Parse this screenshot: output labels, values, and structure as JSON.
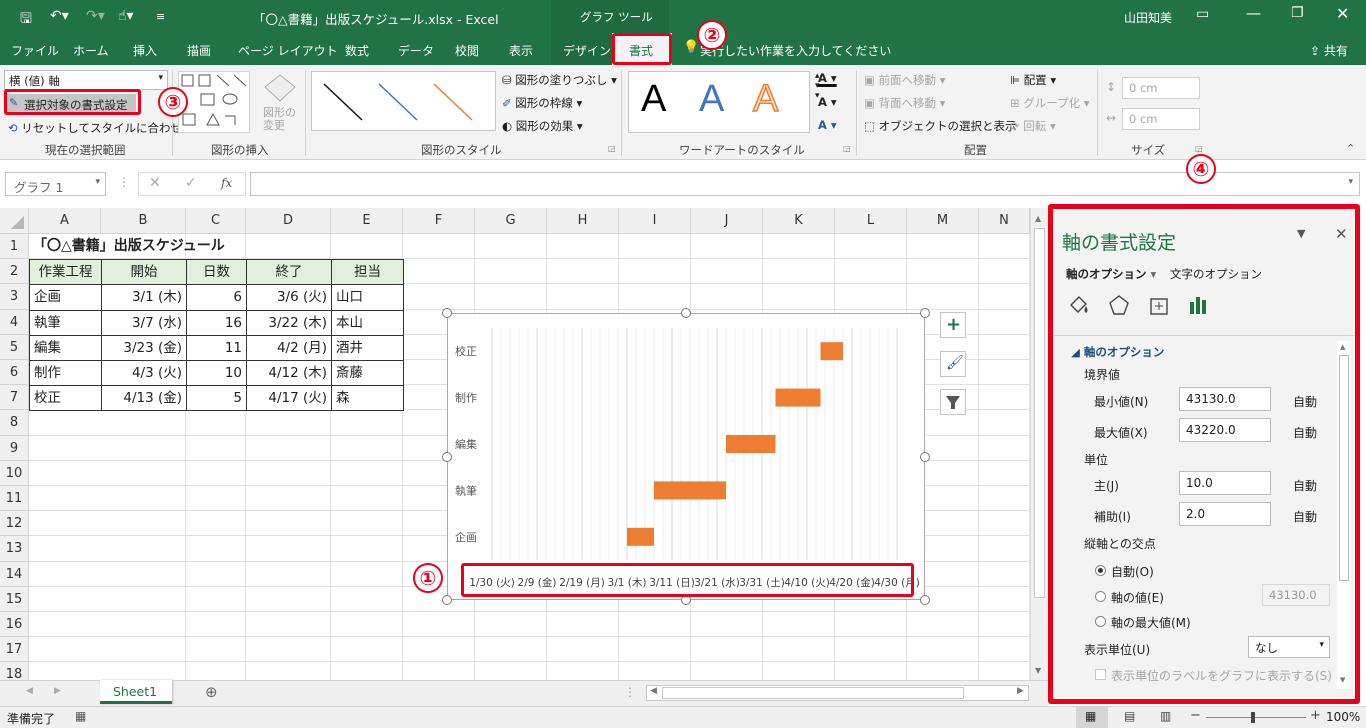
{
  "title_bar": {
    "filename": "「〇△書籍」出版スケジュール.xlsx",
    "separator": "-",
    "app": "Excel",
    "context_tool": "グラフ ツール",
    "user": "山田知美"
  },
  "tabs": {
    "file": "ファイル",
    "home": "ホーム",
    "insert": "挿入",
    "draw": "描画",
    "page_layout": "ページ レイアウト",
    "formulas": "数式",
    "data": "データ",
    "review": "校閲",
    "view": "表示",
    "design": "デザイン",
    "format": "書式",
    "tell_me": "実行したい作業を入力してください",
    "share": "共有"
  },
  "ribbon": {
    "selection_dropdown": "横 (値) 軸",
    "format_selection": "選択対象の書式設定",
    "reset_style": "リセットしてスタイルに合わせる",
    "group_selection": "現在の選択範囲",
    "change_shape": "図形の変更",
    "group_insert_shapes": "図形の挿入",
    "shape_fill": "図形の塗りつぶし",
    "shape_outline": "図形の枠線",
    "shape_effects": "図形の効果",
    "group_shape_styles": "図形のスタイル",
    "wordart_letter": "A",
    "group_wordart": "ワードアートのスタイル",
    "bring_forward": "前面へ移動",
    "send_backward": "背面へ移動",
    "selection_pane": "オブジェクトの選択と表示",
    "align": "配置",
    "group_obj": "グループ化",
    "rotate": "回転",
    "group_arrange": "配置",
    "height": "0 cm",
    "width": "0 cm",
    "group_size": "サイズ"
  },
  "formula_bar": {
    "name_box": "グラフ 1",
    "fx": "fx",
    "value": ""
  },
  "grid": {
    "columns": [
      "A",
      "B",
      "C",
      "D",
      "E",
      "F",
      "G",
      "H",
      "I",
      "J",
      "K",
      "L",
      "M",
      "N"
    ],
    "rows": [
      "1",
      "2",
      "3",
      "4",
      "5",
      "6",
      "7",
      "8",
      "9",
      "10",
      "11",
      "12",
      "13",
      "14",
      "15",
      "16",
      "17",
      "18"
    ],
    "title": "「〇△書籍」出版スケジュール",
    "headers": [
      "作業工程",
      "開始",
      "日数",
      "終了",
      "担当"
    ],
    "table": [
      [
        "企画",
        "3/1 (木)",
        "6",
        "3/6 (火)",
        "山口"
      ],
      [
        "執筆",
        "3/7 (水)",
        "16",
        "3/22 (木)",
        "本山"
      ],
      [
        "編集",
        "3/23 (金)",
        "11",
        "4/2 (月)",
        "酒井"
      ],
      [
        "制作",
        "4/3 (火)",
        "10",
        "4/12 (木)",
        "斎藤"
      ],
      [
        "校正",
        "4/13 (金)",
        "5",
        "4/17 (火)",
        "森"
      ]
    ]
  },
  "chart_data": {
    "type": "bar",
    "orientation": "horizontal-stacked-gantt",
    "categories": [
      "企画",
      "執筆",
      "編集",
      "制作",
      "校正"
    ],
    "x_tick_labels": [
      "1/30 (火)",
      "2/9 (金)",
      "2/19 (月)",
      "3/1 (木)",
      "3/11 (日)",
      "3/21 (水)",
      "3/31 (土)",
      "4/10 (火)",
      "4/20 (金)",
      "4/30 (月)"
    ],
    "x_min": 43130,
    "x_max": 43220,
    "major_unit": 10,
    "minor_unit": 2,
    "series": [
      {
        "values": [
          43160,
          43166,
          43182,
          43193,
          43203
        ]
      },
      {
        "values": [
          6,
          16,
          11,
          10,
          5
        ]
      }
    ],
    "bar_color": "#ed7d31",
    "grid": true,
    "legend": "none"
  },
  "sheet_tabs": {
    "active": "Sheet1"
  },
  "status": {
    "ready": "準備完了",
    "zoom": "100%"
  },
  "pane": {
    "title": "軸の書式設定",
    "tab_axis": "軸のオプション",
    "tab_text": "文字のオプション",
    "section": "軸のオプション",
    "bounds": "境界値",
    "min_label": "最小値(N)",
    "min_value": "43130.0",
    "min_auto": "自動",
    "max_label": "最大値(X)",
    "max_value": "43220.0",
    "max_auto": "自動",
    "units": "単位",
    "major_label": "主(J)",
    "major_value": "10.0",
    "major_auto": "自動",
    "minor_label": "補助(I)",
    "minor_value": "2.0",
    "minor_auto": "自動",
    "crosses": "縦軸との交点",
    "opt_auto": "自動(O)",
    "opt_value": "軸の値(E)",
    "opt_value_input": "43130.0",
    "opt_max": "軸の最大値(M)",
    "display_units": "表示単位(U)",
    "display_units_value": "なし",
    "show_label": "表示単位のラベルをグラフに表示する(S)"
  },
  "badges": [
    "①",
    "②",
    "③",
    "④"
  ]
}
